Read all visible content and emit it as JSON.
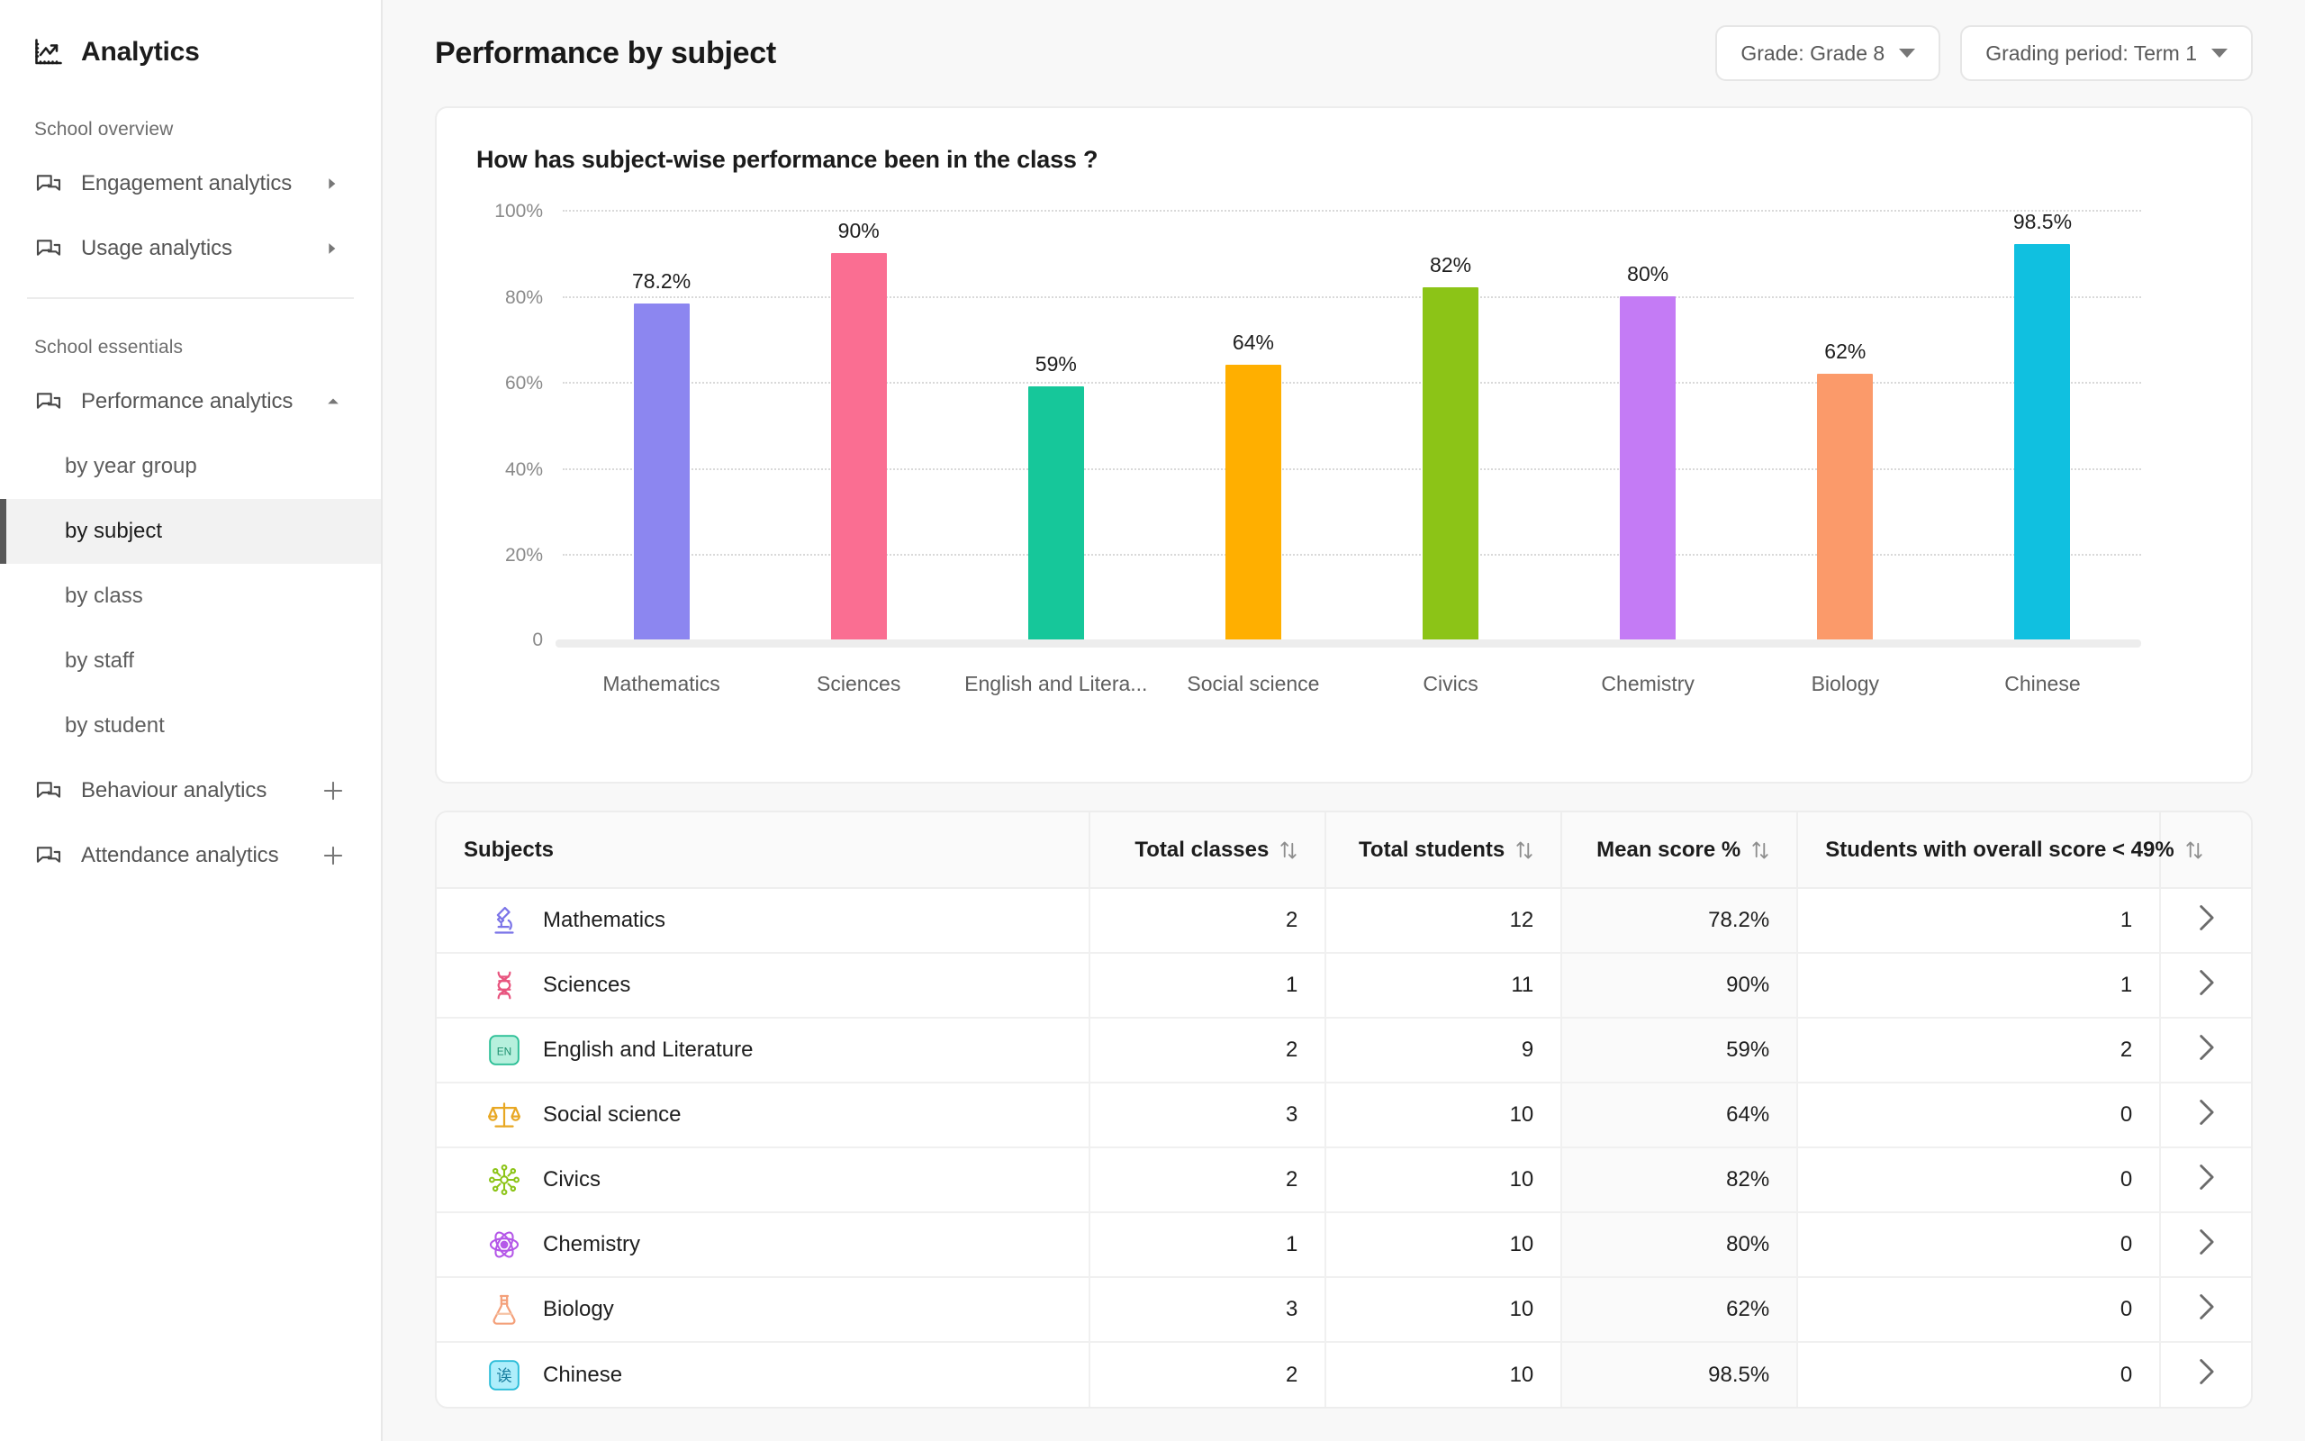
{
  "sidebar": {
    "brand": {
      "title": "Analytics",
      "icon": "analytics-chart-icon"
    },
    "groups": [
      {
        "label": "School overview",
        "items": [
          {
            "label": "Engagement analytics",
            "icon": "chat-bubbles-icon",
            "affix": "chevron-right"
          },
          {
            "label": "Usage analytics",
            "icon": "chat-bubbles-icon",
            "affix": "chevron-right"
          }
        ]
      },
      {
        "label": "School essentials",
        "items": [
          {
            "label": "Performance analytics",
            "icon": "chat-bubbles-icon",
            "affix": "chevron-up"
          },
          {
            "label": "Behaviour analytics",
            "icon": "chat-bubbles-icon",
            "affix": "plus"
          },
          {
            "label": "Attendance analytics",
            "icon": "chat-bubbles-icon",
            "affix": "plus"
          }
        ]
      }
    ],
    "subitems": [
      {
        "label": "by year group",
        "active": false
      },
      {
        "label": "by subject",
        "active": true
      },
      {
        "label": "by class",
        "active": false
      },
      {
        "label": "by staff",
        "active": false
      },
      {
        "label": "by student",
        "active": false
      }
    ]
  },
  "header": {
    "title": "Performance by subject",
    "filters": [
      {
        "label": "Grade: Grade 8"
      },
      {
        "label": "Grading period: Term 1"
      }
    ]
  },
  "chart_card": {
    "title": "How has subject-wise performance been in the class ?"
  },
  "chart_data": {
    "type": "bar",
    "title": "How has subject-wise performance been in the class ?",
    "xlabel": "",
    "ylabel": "",
    "ylim": [
      0,
      100
    ],
    "grid": true,
    "legend": "none",
    "ytick_labels": [
      "100%",
      "80%",
      "60%",
      "40%",
      "20%",
      "0"
    ],
    "ytick_values": [
      100,
      80,
      60,
      40,
      20,
      0
    ],
    "categories": [
      "Mathematics",
      "Sciences",
      "English and Litera...",
      "Social science",
      "Civics",
      "Chemistry",
      "Biology",
      "Chinese"
    ],
    "values": [
      78.2,
      90,
      59,
      64,
      82,
      80,
      62,
      98.5
    ],
    "value_labels": [
      "78.2%",
      "90%",
      "59%",
      "64%",
      "82%",
      "80%",
      "62%",
      "98.5%"
    ],
    "colors": [
      "#8c86f0",
      "#fa6e92",
      "#16c79a",
      "#ffaf00",
      "#8cc417",
      "#c47bf5",
      "#fb9a6a",
      "#10c0e0"
    ]
  },
  "table": {
    "columns": [
      {
        "label": "Subjects",
        "align": "left",
        "sortable": false
      },
      {
        "label": "Total classes",
        "align": "right",
        "sortable": true
      },
      {
        "label": "Total students",
        "align": "right",
        "sortable": true
      },
      {
        "label": "Mean score %",
        "align": "right",
        "sortable": true
      },
      {
        "label": "Students with overall score < 49%",
        "align": "right",
        "sortable": true
      },
      {
        "label": "",
        "align": "center",
        "sortable": false
      }
    ],
    "rows": [
      {
        "subject": "Mathematics",
        "icon": "microscope-icon",
        "total_classes": "2",
        "total_students": "12",
        "mean_score": "78.2%",
        "low_scorers": "1"
      },
      {
        "subject": "Sciences",
        "icon": "dna-icon",
        "total_classes": "1",
        "total_students": "11",
        "mean_score": "90%",
        "low_scorers": "1"
      },
      {
        "subject": "English and Literature",
        "icon": "en-badge-icon",
        "total_classes": "2",
        "total_students": "9",
        "mean_score": "59%",
        "low_scorers": "2"
      },
      {
        "subject": "Social science",
        "icon": "scales-icon",
        "total_classes": "3",
        "total_students": "10",
        "mean_score": "64%",
        "low_scorers": "0"
      },
      {
        "subject": "Civics",
        "icon": "network-icon",
        "total_classes": "2",
        "total_students": "10",
        "mean_score": "82%",
        "low_scorers": "0"
      },
      {
        "subject": "Chemistry",
        "icon": "atom-icon",
        "total_classes": "1",
        "total_students": "10",
        "mean_score": "80%",
        "low_scorers": "0"
      },
      {
        "subject": "Biology",
        "icon": "flask-icon",
        "total_classes": "3",
        "total_students": "10",
        "mean_score": "62%",
        "low_scorers": "0"
      },
      {
        "subject": "Chinese",
        "icon": "chinese-badge-icon",
        "total_classes": "2",
        "total_students": "10",
        "mean_score": "98.5%",
        "low_scorers": "0"
      }
    ]
  }
}
